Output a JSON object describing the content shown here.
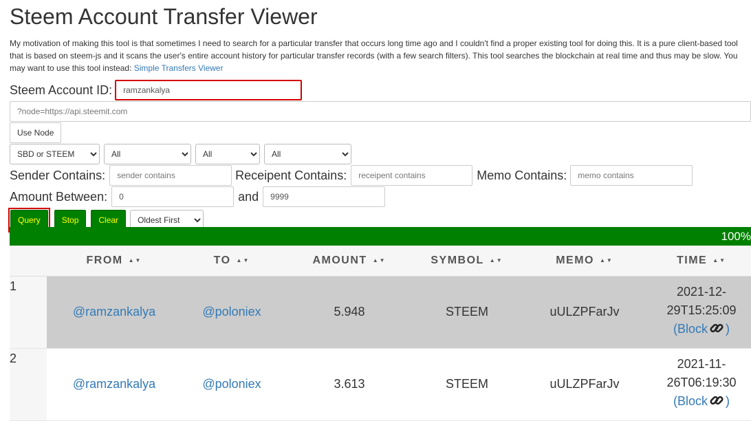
{
  "page": {
    "title": "Steem Account Transfer Viewer",
    "intro_text": "My motivation of making this tool is that sometimes I need to search for a particular transfer that occurs long time ago and I couldn't find a proper existing tool for doing this. It is a pure client-based tool that is based on steem-js and it scans the user's entire account history for particular transfer records (with a few search filters). This tool searches the blockchain at real time and thus may be slow. You may want to use this tool instead: ",
    "intro_link": "Simple Transfers Viewer"
  },
  "form": {
    "account_label": "Steem Account ID:",
    "account_value": "ramzankalya",
    "node_placeholder": "?node=https://api.steemit.com",
    "use_node_label": "Use Node",
    "currency_select": "SBD or STEEM",
    "filter_select_1": "All",
    "filter_select_2": "All",
    "filter_select_3": "All",
    "sender_label": "Sender Contains:",
    "sender_placeholder": "sender contains",
    "receipent_label": "Receipent Contains:",
    "receipent_placeholder": "receipent contains",
    "memo_label": "Memo Contains:",
    "memo_placeholder": "memo contains",
    "amount_label": "Amount Between:",
    "amount_min": "0",
    "and_label": "and",
    "amount_max": "9999",
    "query_label": "Query",
    "stop_label": "Stop",
    "clear_label": "Clear",
    "order_select": "Oldest First"
  },
  "progress": {
    "percent": 100,
    "label": "100%"
  },
  "table": {
    "headers": [
      "FROM",
      "TO",
      "AMOUNT",
      "SYMBOL",
      "MEMO",
      "TIME"
    ],
    "sort_glyph": "▲▼",
    "rows": [
      {
        "index": "1",
        "from": "@ramzankalya",
        "to": "@poloniex",
        "amount": "5.948",
        "symbol": "STEEM",
        "memo": "uULZPFarJv",
        "time_line1": "2021-12-",
        "time_line2": "29T15:25:09",
        "block_open": "(Block",
        "block_close": ")"
      },
      {
        "index": "2",
        "from": "@ramzankalya",
        "to": "@poloniex",
        "amount": "3.613",
        "symbol": "STEEM",
        "memo": "uULZPFarJv",
        "time_line1": "2021-11-",
        "time_line2": "26T06:19:30",
        "block_open": "(Block",
        "block_close": ")"
      }
    ]
  },
  "colors": {
    "accent_green": "#008000",
    "button_text_yellow": "#ffff00",
    "highlight_red": "#d40000",
    "link_blue": "#337ab7"
  }
}
